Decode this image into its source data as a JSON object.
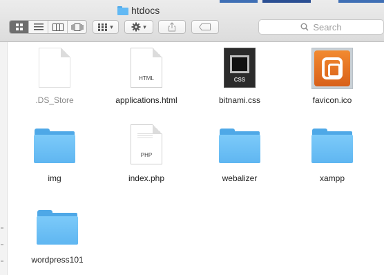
{
  "window": {
    "title": "htdocs"
  },
  "toolbar": {
    "arrange_label": "▾",
    "action_label": "▾",
    "search_placeholder": "Search"
  },
  "files": [
    {
      "name": ".DS_Store",
      "kind": "blank-doc"
    },
    {
      "name": "applications.html",
      "kind": "doc",
      "ext": "HTML"
    },
    {
      "name": "bitnami.css",
      "kind": "css",
      "ext": "CSS"
    },
    {
      "name": "favicon.ico",
      "kind": "favicon"
    },
    {
      "name": "img",
      "kind": "folder"
    },
    {
      "name": "index.php",
      "kind": "doc",
      "ext": "PHP"
    },
    {
      "name": "webalizer",
      "kind": "folder"
    },
    {
      "name": "xampp",
      "kind": "folder"
    },
    {
      "name": "wordpress101",
      "kind": "folder"
    }
  ],
  "colors": {
    "folder": "#62b9f4",
    "accent": "#6e6e6e"
  }
}
